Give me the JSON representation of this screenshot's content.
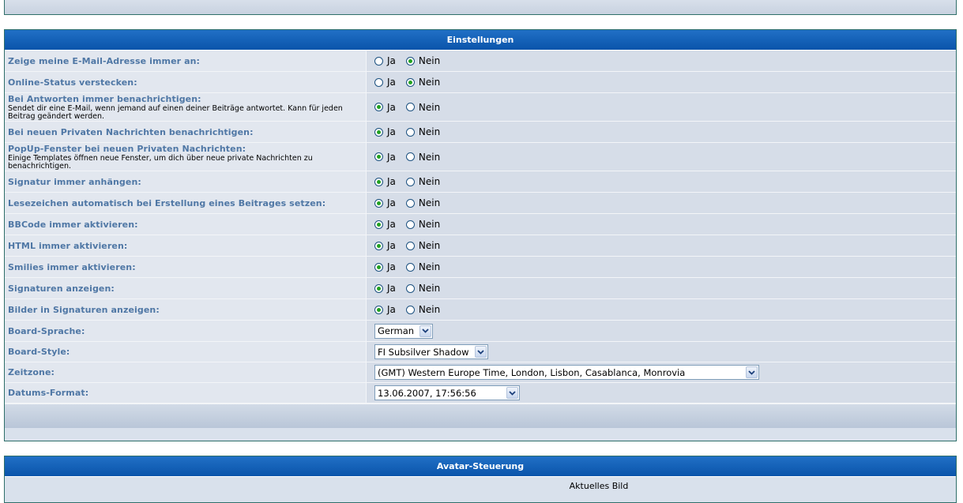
{
  "settings": {
    "title": "Einstellungen",
    "rows": [
      {
        "label": "Zeige meine E-Mail-Adresse immer an:",
        "desc": "",
        "ja": "Ja",
        "nein": "Nein",
        "selected": "nein"
      },
      {
        "label": "Online-Status verstecken:",
        "desc": "",
        "ja": "Ja",
        "nein": "Nein",
        "selected": "nein"
      },
      {
        "label": "Bei Antworten immer benachrichtigen:",
        "desc": "Sendet dir eine E-Mail, wenn jemand auf einen deiner Beiträge antwortet. Kann für jeden Beitrag geändert werden.",
        "ja": "Ja",
        "nein": "Nein",
        "selected": "ja"
      },
      {
        "label": "Bei neuen Privaten Nachrichten benachrichtigen:",
        "desc": "",
        "ja": "Ja",
        "nein": "Nein",
        "selected": "ja"
      },
      {
        "label": "PopUp-Fenster bei neuen Privaten Nachrichten:",
        "desc": "Einige Templates öffnen neue Fenster, um dich über neue private Nachrichten zu benachrichtigen.",
        "ja": "Ja",
        "nein": "Nein",
        "selected": "ja"
      },
      {
        "label": "Signatur immer anhängen:",
        "desc": "",
        "ja": "Ja",
        "nein": "Nein",
        "selected": "ja"
      },
      {
        "label": "Lesezeichen automatisch bei Erstellung eines Beitrages setzen:",
        "desc": "",
        "ja": "Ja",
        "nein": "Nein",
        "selected": "ja"
      },
      {
        "label": "BBCode immer aktivieren:",
        "desc": "",
        "ja": "Ja",
        "nein": "Nein",
        "selected": "ja"
      },
      {
        "label": "HTML immer aktivieren:",
        "desc": "",
        "ja": "Ja",
        "nein": "Nein",
        "selected": "ja"
      },
      {
        "label": "Smilies immer aktivieren:",
        "desc": "",
        "ja": "Ja",
        "nein": "Nein",
        "selected": "ja"
      },
      {
        "label": "Signaturen anzeigen:",
        "desc": "",
        "ja": "Ja",
        "nein": "Nein",
        "selected": "ja"
      },
      {
        "label": "Bilder in Signaturen anzeigen:",
        "desc": "",
        "ja": "Ja",
        "nein": "Nein",
        "selected": "ja"
      }
    ],
    "board_language": {
      "label": "Board-Sprache:",
      "value": "German"
    },
    "board_style": {
      "label": "Board-Style:",
      "value": "FI Subsilver Shadow"
    },
    "timezone": {
      "label": "Zeitzone:",
      "value": "(GMT) Western Europe Time, London, Lisbon, Casablanca, Monrovia"
    },
    "date_format": {
      "label": "Datums-Format:",
      "value": "13.06.2007, 17:56:56"
    }
  },
  "avatar": {
    "title": "Avatar-Steuerung",
    "current_image_label": "Aktuelles Bild"
  },
  "colors": {
    "header_blue": "#0a54aa",
    "label_blue": "#4f77a5",
    "radio_green": "#21a121"
  }
}
